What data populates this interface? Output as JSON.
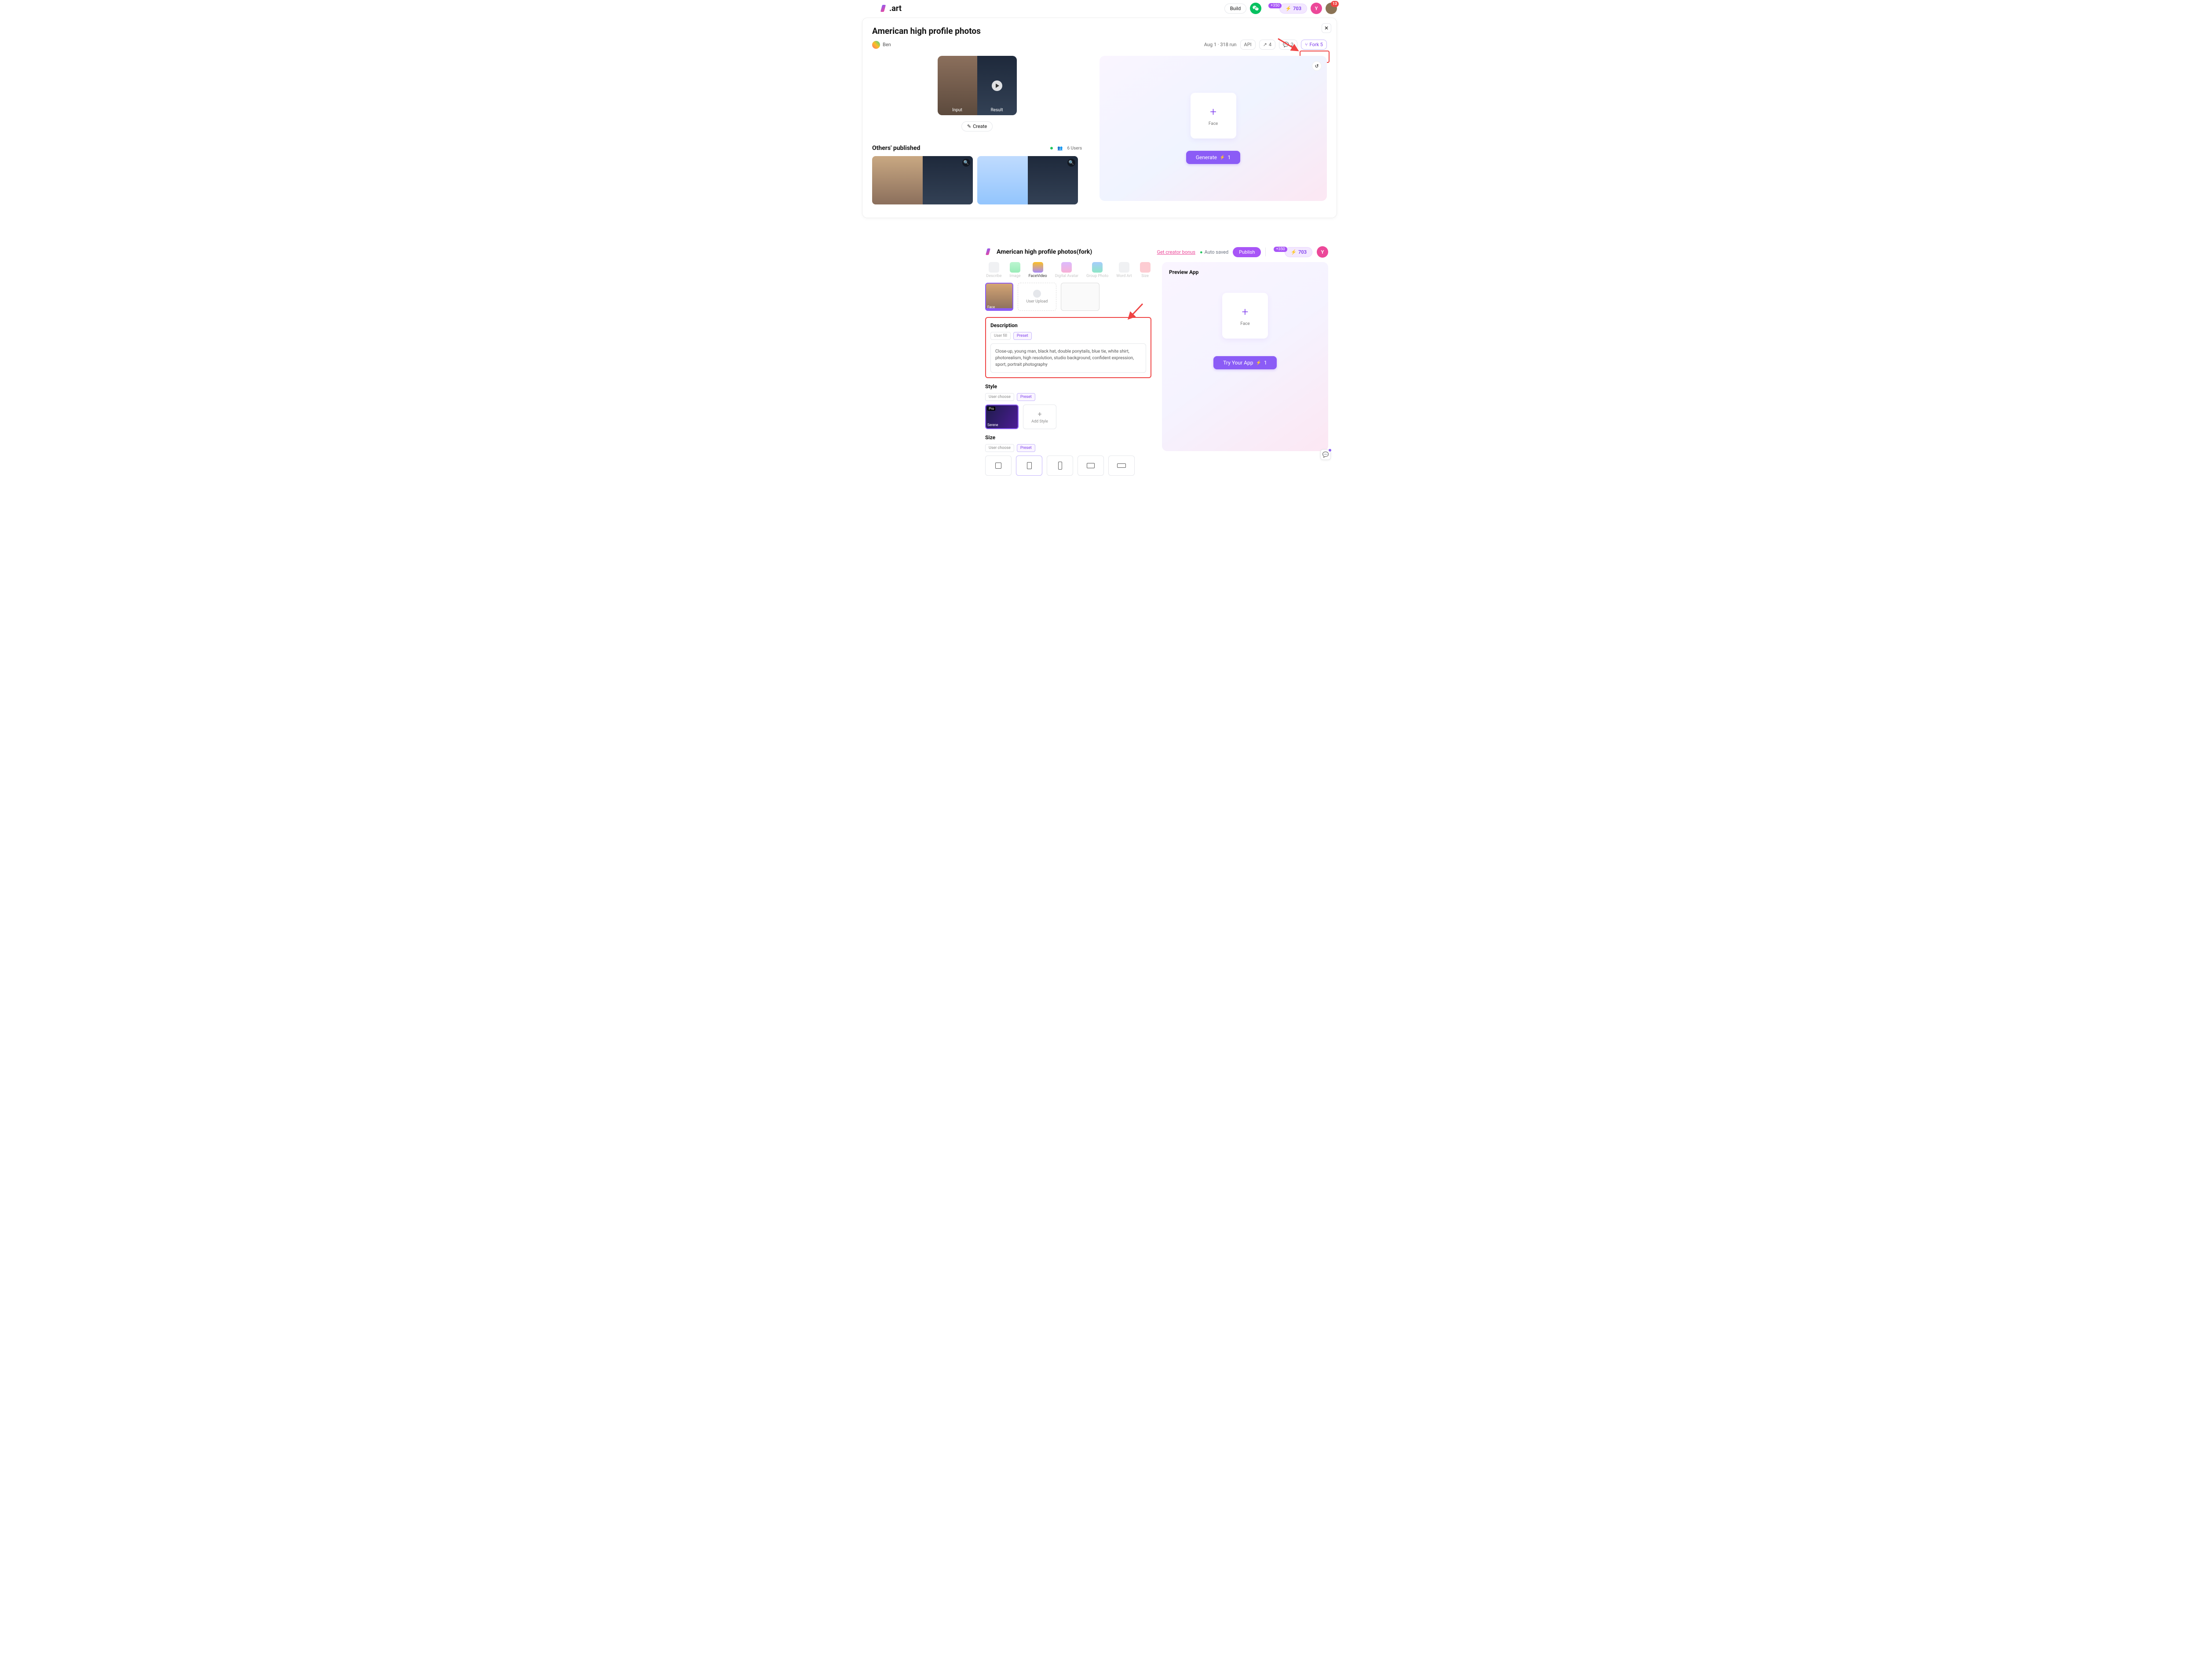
{
  "panel1": {
    "logo_text": ".art",
    "build_label": "Build",
    "credits_bonus": "+350",
    "credits_value": "703",
    "avatar_initial": "Y",
    "avatar2_notif": "13",
    "card": {
      "title": "American high profile photos",
      "author": "Ben",
      "date_runs": "Aug 1 · 318 run",
      "api_label": "API",
      "share_count": "4",
      "comment_count": "2",
      "fork_label": "Fork 5",
      "input_label": "Input",
      "result_label": "Result",
      "create_label": "Create",
      "others_title": "Others' published",
      "users_label": "6 Users",
      "face_label": "Face",
      "generate_label": "Generate",
      "generate_cost": "1"
    }
  },
  "panel2": {
    "title": "American high profile photos(fork)",
    "bonus_link": "Get creator bonus",
    "autosaved": "Auto saved",
    "publish": "Publish",
    "credits_bonus": "+350",
    "credits_value": "703",
    "avatar_initial": "Y",
    "tabs": {
      "describe": "Describe",
      "image": "Image",
      "facevideo": "FaceVideo",
      "avatar": "Digital Avatar",
      "group": "Group Photo",
      "wordart": "Word Art",
      "size": "Size"
    },
    "face_tag": "Face",
    "user_upload": "User Upload",
    "desc_title": "Description",
    "mode_userfill": "User fill",
    "mode_preset": "Preset",
    "desc_text": "Close-up, young man, black hat, double ponytails, blue tie, white shirt, photorealism, high resolution, studio background, confident expression, sport, portrait photography",
    "style_title": "Style",
    "mode_userchoose": "User choose",
    "style_pro": "Pro",
    "style_name": "Serene",
    "add_style": "Add Style",
    "size_title": "Size",
    "preview_title": "Preview App",
    "face_label": "Face",
    "try_label": "Try Your App",
    "try_cost": "1"
  }
}
